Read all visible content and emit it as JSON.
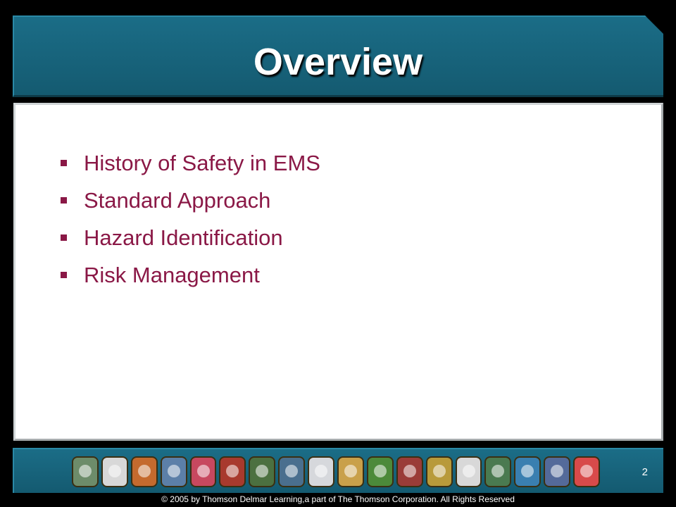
{
  "slide": {
    "title": "Overview",
    "bullets": [
      "History of Safety in EMS",
      "Standard Approach",
      "Hazard Identification",
      "Risk Management"
    ],
    "page_number": "2",
    "copyright": "© 2005 by Thomson Delmar Learning,a part of The Thomson Corporation. All Rights Reserved"
  },
  "colors": {
    "title_band": "#1b6d87",
    "bullet_text": "#8a1846",
    "patches": [
      "#6d8c6a",
      "#d8d8d8",
      "#c46a2e",
      "#5c7fa8",
      "#c7485f",
      "#a83a2e",
      "#4c7040",
      "#4a6f8e",
      "#d6d8dc",
      "#c9a04a",
      "#4c8a3a",
      "#9a3c38",
      "#b89a3a",
      "#d8d8d8",
      "#4a7a50",
      "#3a7fb0",
      "#546a9a",
      "#d84a4a"
    ]
  }
}
